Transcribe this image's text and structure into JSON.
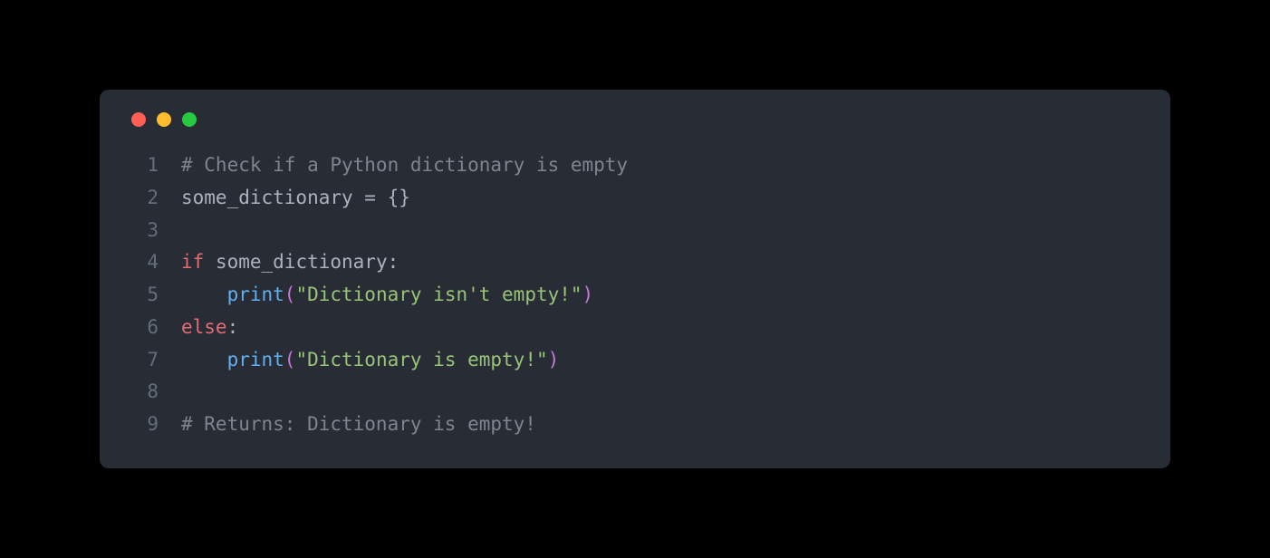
{
  "window": {
    "controls": [
      "close",
      "minimize",
      "maximize"
    ]
  },
  "code": {
    "lines": [
      {
        "num": "1",
        "tokens": [
          {
            "cls": "tok-comment",
            "text": "# Check if a Python dictionary is empty"
          }
        ]
      },
      {
        "num": "2",
        "tokens": [
          {
            "cls": "tok-default",
            "text": "some_dictionary "
          },
          {
            "cls": "tok-operator",
            "text": "="
          },
          {
            "cls": "tok-default",
            "text": " "
          },
          {
            "cls": "tok-punct",
            "text": "{}"
          }
        ]
      },
      {
        "num": "3",
        "tokens": []
      },
      {
        "num": "4",
        "tokens": [
          {
            "cls": "tok-keyword",
            "text": "if"
          },
          {
            "cls": "tok-default",
            "text": " some_dictionary"
          },
          {
            "cls": "tok-punct",
            "text": ":"
          }
        ]
      },
      {
        "num": "5",
        "tokens": [
          {
            "cls": "tok-default",
            "text": "    "
          },
          {
            "cls": "tok-builtin",
            "text": "print"
          },
          {
            "cls": "tok-paren",
            "text": "("
          },
          {
            "cls": "tok-string",
            "text": "\"Dictionary isn't empty!\""
          },
          {
            "cls": "tok-paren",
            "text": ")"
          }
        ]
      },
      {
        "num": "6",
        "tokens": [
          {
            "cls": "tok-keyword",
            "text": "else"
          },
          {
            "cls": "tok-punct",
            "text": ":"
          }
        ]
      },
      {
        "num": "7",
        "tokens": [
          {
            "cls": "tok-default",
            "text": "    "
          },
          {
            "cls": "tok-builtin",
            "text": "print"
          },
          {
            "cls": "tok-paren",
            "text": "("
          },
          {
            "cls": "tok-string",
            "text": "\"Dictionary is empty!\""
          },
          {
            "cls": "tok-paren",
            "text": ")"
          }
        ]
      },
      {
        "num": "8",
        "tokens": []
      },
      {
        "num": "9",
        "tokens": [
          {
            "cls": "tok-comment",
            "text": "# Returns: Dictionary is empty!"
          }
        ]
      }
    ]
  }
}
